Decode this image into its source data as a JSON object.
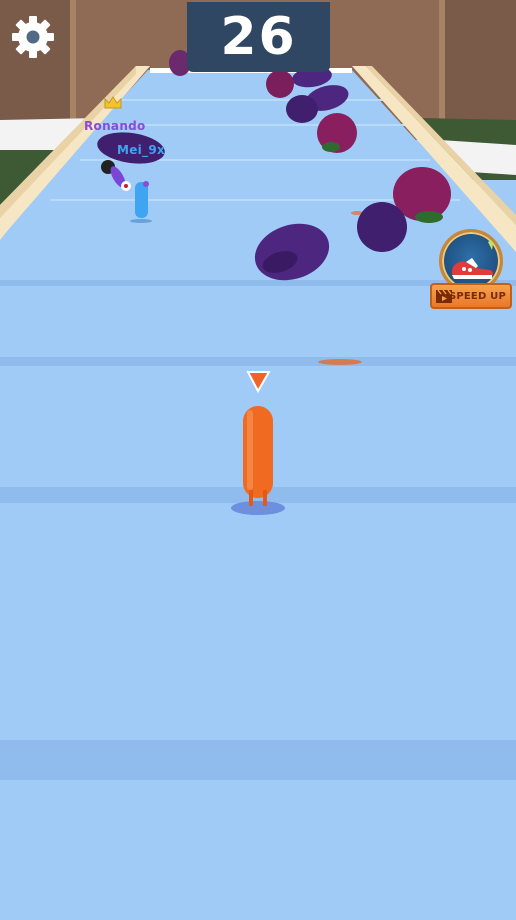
{
  "hud": {
    "score": "26",
    "settings_icon": "gear-icon"
  },
  "players": [
    {
      "name": "Ronando",
      "color": "#8a4bd6",
      "badge_icon": "crown-icon"
    },
    {
      "name": "Mei_9x",
      "color": "#3fa4f2"
    }
  ],
  "powerup": {
    "label": "SPEED UP",
    "icons": [
      "sneaker-icon",
      "clapperboard-icon"
    ]
  },
  "colors": {
    "track": "#9fcbf6",
    "rail": "#f6e6c4",
    "player": "#f06a22",
    "eggplant": "#4d2680",
    "score_board": "#2f4763"
  }
}
